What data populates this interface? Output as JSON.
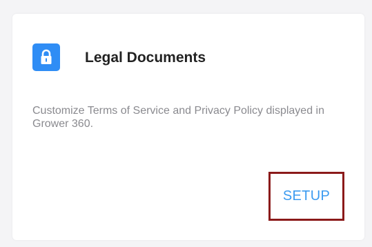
{
  "card": {
    "icon": "lock-icon",
    "title": "Legal Documents",
    "description": "Customize Terms of Service and Privacy Policy displayed in Grower 360.",
    "button_label": "SETUP"
  },
  "colors": {
    "icon_bg": "#2f8df5",
    "button_text": "#3a9af0",
    "highlight_border": "#8b1a1a"
  }
}
